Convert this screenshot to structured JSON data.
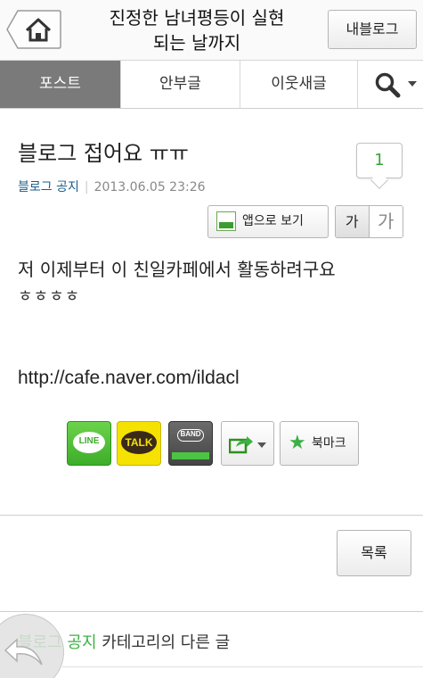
{
  "header": {
    "title": "진정한 남녀평등이 실현\n되는 날까지",
    "my_blog_label": "내블로그",
    "home_icon": "home-icon"
  },
  "tabs": [
    {
      "label": "포스트",
      "active": true
    },
    {
      "label": "안부글",
      "active": false
    },
    {
      "label": "이웃새글",
      "active": false
    }
  ],
  "search_icon": "search-icon",
  "post": {
    "title": "블로그 접어요 ㅠㅠ",
    "comment_count": "1",
    "category": "블로그 공지",
    "date": "2013.06.05 23:26",
    "app_view_label": "앱으로 보기",
    "font_small_label": "가",
    "font_large_label": "가",
    "body_line1": "저 이제부터 이 친일카페에서 활동하려구요",
    "body_line2": "ㅎㅎㅎㅎ",
    "url": "http://cafe.naver.com/ildacl"
  },
  "share": {
    "line_label": "LINE",
    "talk_label": "TALK",
    "band_label": "BAND",
    "bookmark_label": "북마크"
  },
  "list_label": "목록",
  "other_posts": {
    "category": "블로그 공지",
    "suffix": " 카테고리의 다른 글"
  },
  "colors": {
    "accent_green": "#3cb043",
    "category_blue": "#1a5c8a",
    "active_tab_bg": "#7a7a7a"
  }
}
